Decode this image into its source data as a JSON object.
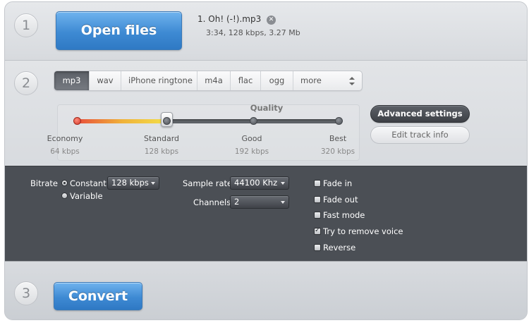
{
  "steps": {
    "one": "1",
    "two": "2",
    "three": "3"
  },
  "open_files": {
    "label": "Open files"
  },
  "file": {
    "name": "1. Oh! (-!).mp3",
    "meta": "3:34, 128 kbps, 3.27 Mb",
    "remove_icon": "close-circle-icon"
  },
  "formats": {
    "items": [
      "mp3",
      "wav",
      "iPhone ringtone",
      "m4a",
      "flac",
      "ogg",
      "more"
    ],
    "selected": "mp3"
  },
  "quality": {
    "label": "Quality",
    "selected_index": 1,
    "levels": [
      {
        "name": "Economy",
        "kbps": "64 kbps"
      },
      {
        "name": "Standard",
        "kbps": "128 kbps"
      },
      {
        "name": "Good",
        "kbps": "192 kbps"
      },
      {
        "name": "Best",
        "kbps": "320 kbps"
      }
    ]
  },
  "buttons": {
    "advanced": "Advanced settings",
    "edit_track": "Edit track info",
    "convert": "Convert"
  },
  "advanced": {
    "bitrate_label": "Bitrate",
    "constant_label": "Constant",
    "variable_label": "Variable",
    "bitrate_mode": "constant",
    "bitrate_value": "128 kbps",
    "sample_rate_label": "Sample rate",
    "sample_rate_value": "44100 Khz",
    "channels_label": "Channels",
    "channels_value": "2",
    "options": [
      {
        "label": "Fade in",
        "checked": false
      },
      {
        "label": "Fade out",
        "checked": false
      },
      {
        "label": "Fast mode",
        "checked": false
      },
      {
        "label": "Try to remove voice",
        "checked": true
      },
      {
        "label": "Reverse",
        "checked": false
      }
    ]
  },
  "colors": {
    "accent_blue": "#3e8ad3",
    "dark_panel": "#4b4f55"
  }
}
